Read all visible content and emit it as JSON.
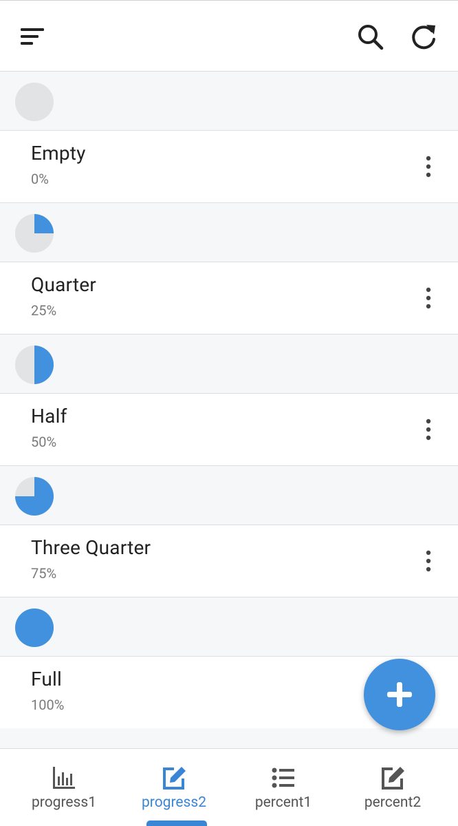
{
  "header": {
    "menu_icon": "sort-lines-icon",
    "search_icon": "search-icon",
    "refresh_icon": "refresh-icon"
  },
  "colors": {
    "accent": "#4191df",
    "pie_empty": "#e2e3e5",
    "active_tab": "#3a86d6"
  },
  "items": [
    {
      "title": "Empty",
      "subtitle": "0%",
      "progress": 0.0
    },
    {
      "title": "Quarter",
      "subtitle": "25%",
      "progress": 0.25
    },
    {
      "title": "Half",
      "subtitle": "50%",
      "progress": 0.5
    },
    {
      "title": "Three Quarter",
      "subtitle": "75%",
      "progress": 0.75
    },
    {
      "title": "Full",
      "subtitle": "100%",
      "progress": 1.0
    }
  ],
  "fab": {
    "icon": "plus-icon"
  },
  "tabs": [
    {
      "label": "progress1",
      "icon": "bar-chart-icon",
      "active": false
    },
    {
      "label": "progress2",
      "icon": "edit-icon",
      "active": true
    },
    {
      "label": "percent1",
      "icon": "list-icon",
      "active": false
    },
    {
      "label": "percent2",
      "icon": "edit-icon",
      "active": false
    }
  ]
}
